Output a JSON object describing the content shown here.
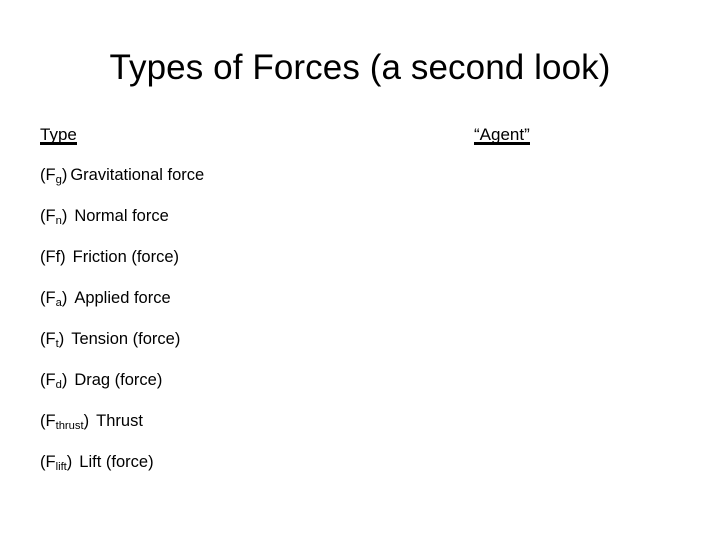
{
  "slide": {
    "title": "Types of Forces (a second look)",
    "background_color": "#ffffff",
    "text_color": "#000000"
  },
  "columns": {
    "type_header": "Type",
    "agent_header": "“Agent”"
  },
  "forces": [
    {
      "symbol_open": "(F",
      "symbol_sub": "g",
      "symbol_close": ")",
      "name": "Gravitational force",
      "spacing": "narrow"
    },
    {
      "symbol_open": "(F",
      "symbol_sub": "n",
      "symbol_close": ")",
      "name": "Normal force",
      "spacing": "wide"
    },
    {
      "symbol_open": "(Ff",
      "symbol_sub": "",
      "symbol_close": ")",
      "name": "Friction (force)",
      "spacing": "wide"
    },
    {
      "symbol_open": "(F",
      "symbol_sub": "a",
      "symbol_close": ")",
      "name": "Applied force",
      "spacing": "wide"
    },
    {
      "symbol_open": "(F",
      "symbol_sub": "t",
      "symbol_close": ")",
      "name": "Tension (force)",
      "spacing": "wide"
    },
    {
      "symbol_open": "(F",
      "symbol_sub": "d",
      "symbol_close": ")",
      "name": "Drag (force)",
      "spacing": "wide"
    },
    {
      "symbol_open": "(F",
      "symbol_sub": "thrust",
      "symbol_close": ")",
      "name": "Thrust",
      "spacing": "wide"
    },
    {
      "symbol_open": "(F",
      "symbol_sub": "lift",
      "symbol_close": ")",
      "name": "Lift (force)",
      "spacing": "wide"
    }
  ],
  "agents": [
    "",
    "",
    "",
    "",
    "",
    "",
    "",
    ""
  ]
}
